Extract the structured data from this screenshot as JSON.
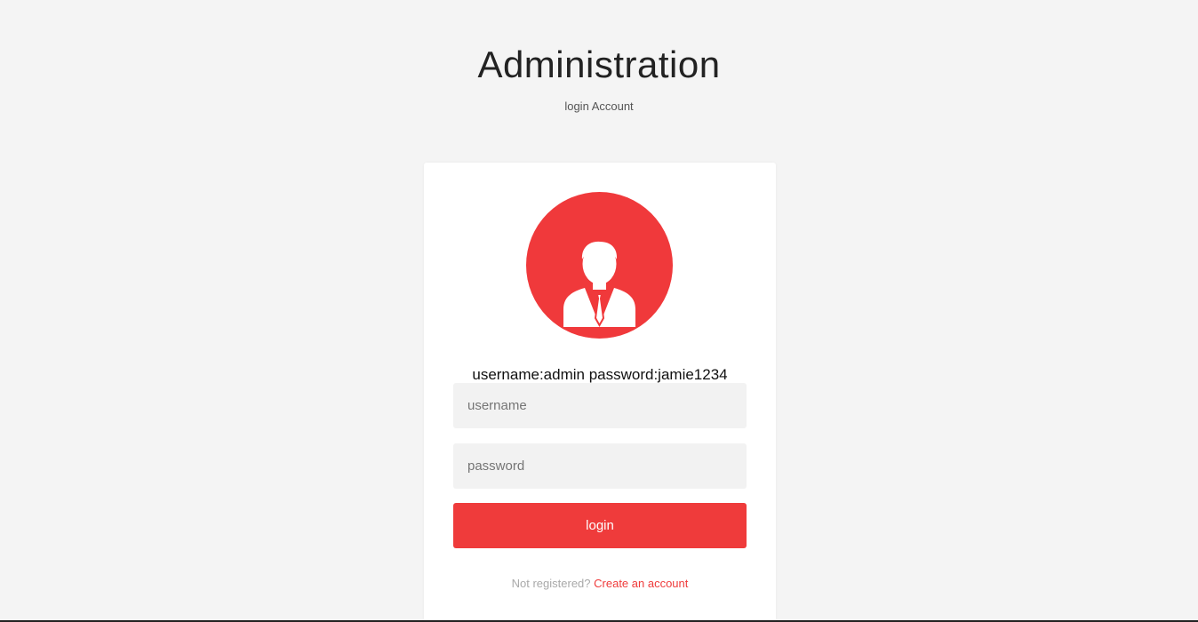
{
  "header": {
    "title": "Administration",
    "subtitle": "login Account"
  },
  "login_form": {
    "avatar_icon": "user-businessman-icon",
    "hint": "username:admin password:jamie1234",
    "username_placeholder": "username",
    "password_placeholder": "password",
    "login_label": "login",
    "register_prompt": "Not registered?",
    "register_link": "Create an account"
  },
  "colors": {
    "accent": "#ef3b3b",
    "background": "#f4f4f4",
    "card": "#ffffff",
    "field": "#f2f2f2"
  }
}
